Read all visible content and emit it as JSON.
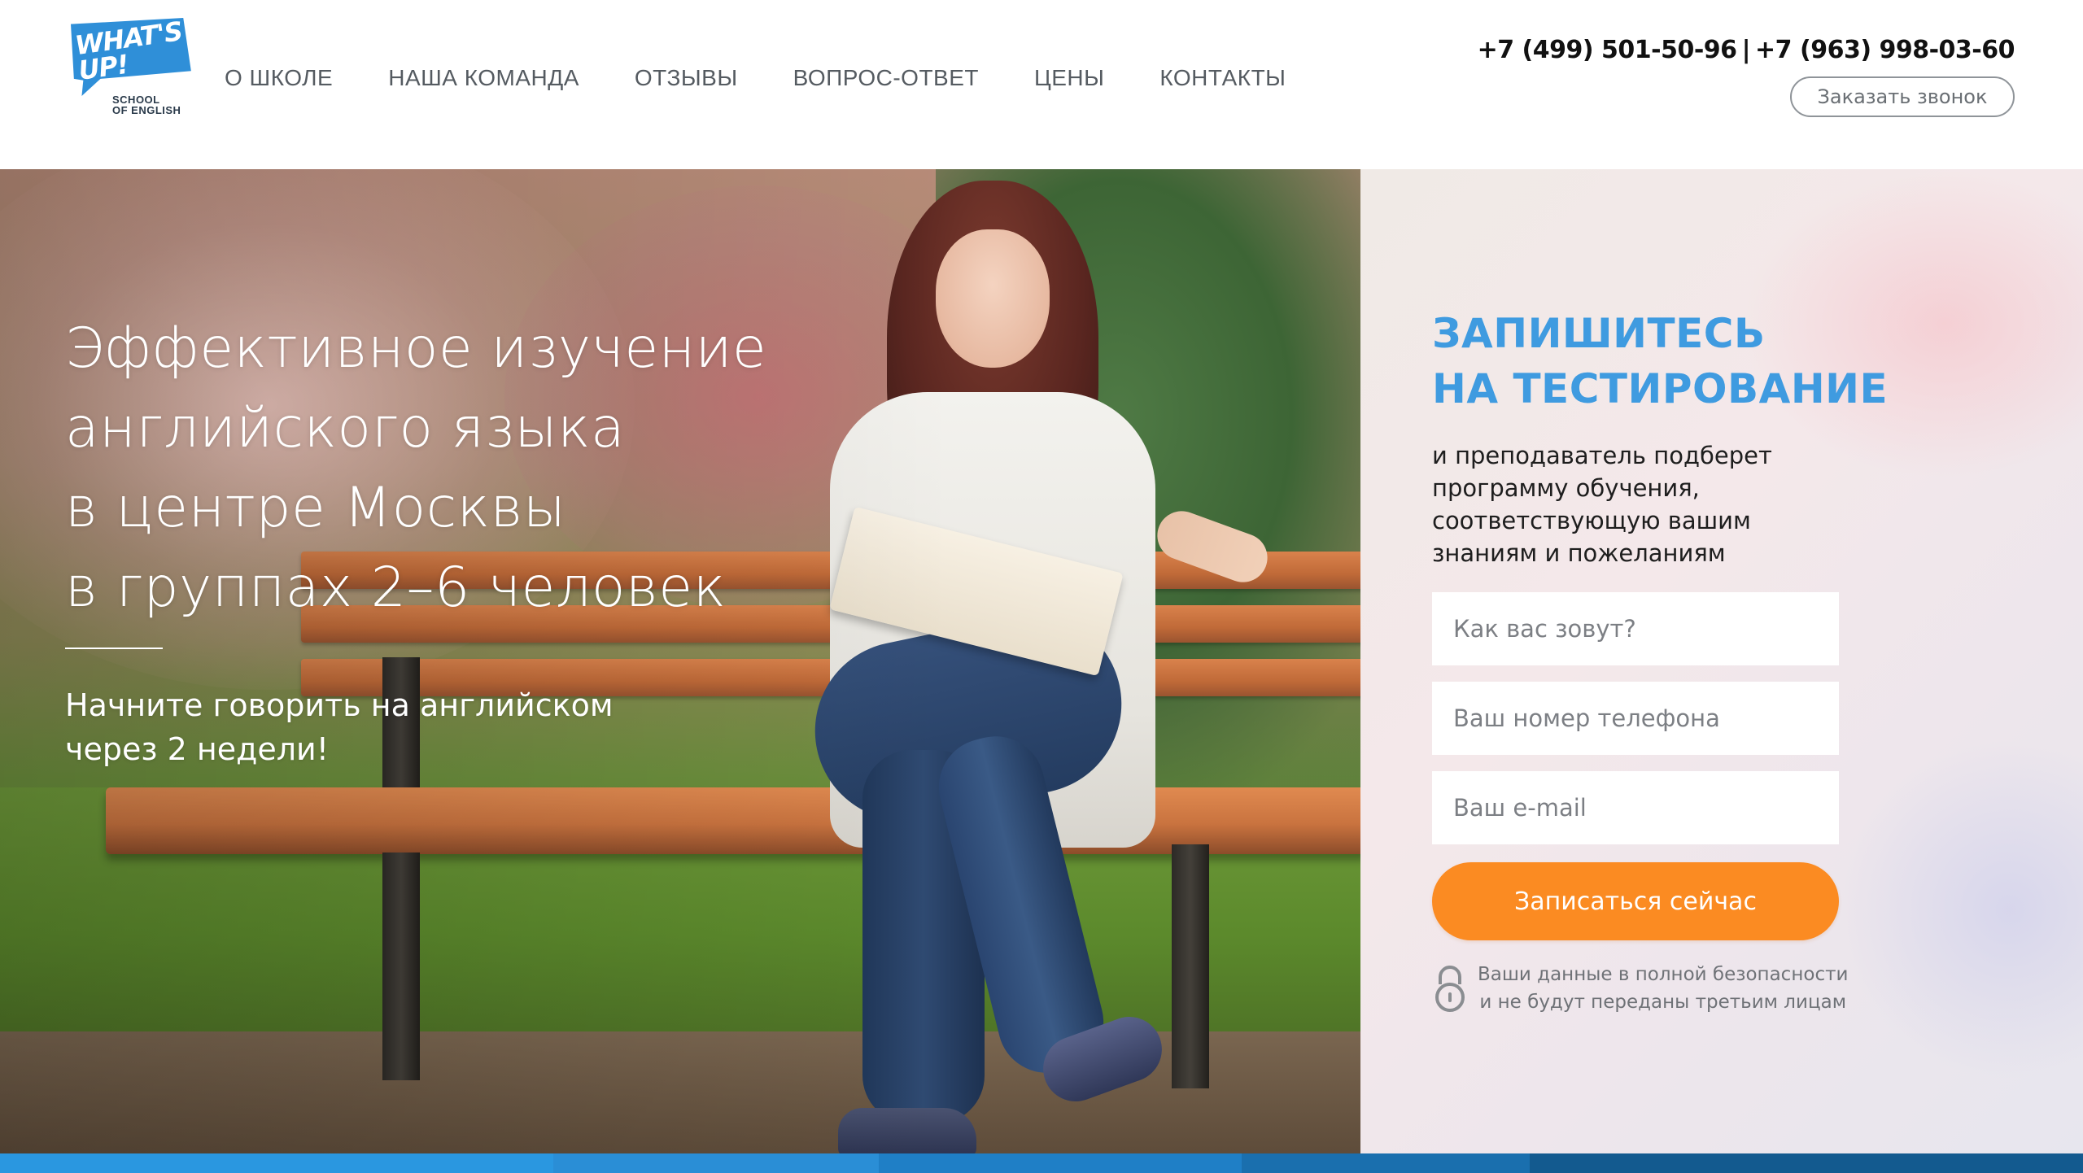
{
  "logo": {
    "badge_text_line1": "WHAT'S",
    "badge_text_line2": "UP!",
    "sub_line1": "SCHOOL",
    "sub_line2": "OF ENGLISH",
    "brand_color": "#2f8fd8"
  },
  "nav": {
    "items": [
      {
        "label": "О ШКОЛЕ"
      },
      {
        "label": "НАША КОМАНДА"
      },
      {
        "label": "ОТЗЫВЫ"
      },
      {
        "label": "ВОПРОС-ОТВЕТ"
      },
      {
        "label": "ЦЕНЫ"
      },
      {
        "label": "КОНТАКТЫ"
      }
    ]
  },
  "contacts": {
    "phone1": "+7 (499) 501-50-96",
    "separator": "|",
    "phone2": "+7 (963) 998-03-60",
    "callback_label": "Заказать звонок"
  },
  "hero": {
    "title_lines": [
      "Эффективное изучение",
      "английского языка",
      "в центре Москвы",
      "в группах 2–6 человек"
    ],
    "subtitle_lines": [
      "Начните говорить на английском",
      "через 2 недели!"
    ]
  },
  "form": {
    "title_lines": [
      "ЗАПИШИТЕСЬ",
      "НА ТЕСТИРОВАНИЕ"
    ],
    "description_lines": [
      "и преподаватель подберет",
      "программу обучения,",
      "соответствующую вашим",
      "знаниям и пожеланиям"
    ],
    "name_placeholder": "Как вас зовут?",
    "phone_placeholder": "Ваш номер телефона",
    "email_placeholder": "Ваш e-mail",
    "submit_label": "Записаться сейчас",
    "privacy_line1": "Ваши данные в полной безопасности",
    "privacy_line2": "и не будут переданы третьим лицам",
    "accent_color": "#fb8b22",
    "title_color": "#3f9be0"
  },
  "bottom_bar": {
    "colors": [
      "#2a97e0",
      "#2a8ed6",
      "#1f7fc6",
      "#1a6fae",
      "#135a8f"
    ]
  }
}
